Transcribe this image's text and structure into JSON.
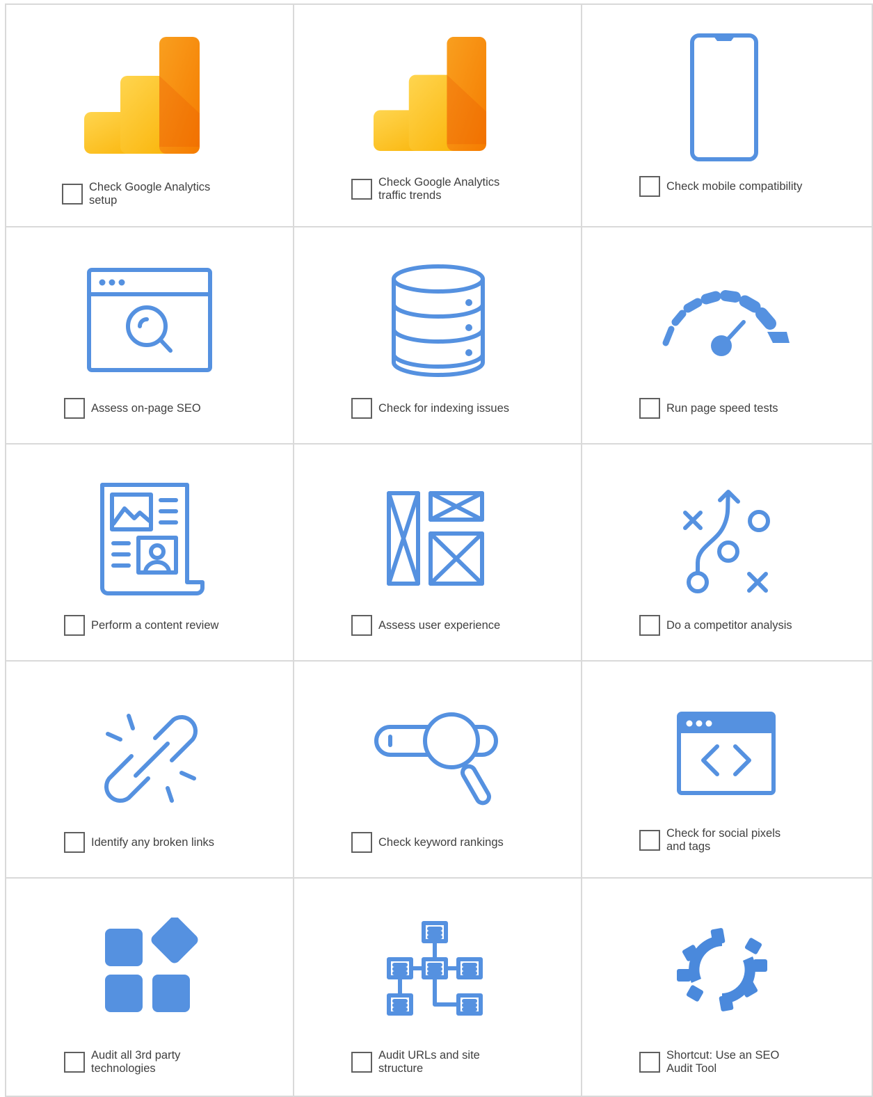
{
  "colors": {
    "icon_blue": "#5591e0",
    "ga_yellow": "#fbc02d",
    "ga_orange": "#f57c00",
    "border": "#d9d9d9"
  },
  "checklist": [
    {
      "label": "Check Google Analytics setup",
      "icon": "google-analytics-icon",
      "checked": false
    },
    {
      "label": "Check Google Analytics traffic trends",
      "icon": "google-analytics-icon",
      "checked": false
    },
    {
      "label": "Check mobile compatibility",
      "icon": "smartphone-icon",
      "checked": false
    },
    {
      "label": "Assess on-page SEO",
      "icon": "browser-search-icon",
      "checked": false
    },
    {
      "label": "Check for indexing issues",
      "icon": "database-icon",
      "checked": false
    },
    {
      "label": "Run page speed tests",
      "icon": "speedometer-icon",
      "checked": false
    },
    {
      "label": "Perform a content review",
      "icon": "content-document-icon",
      "checked": false
    },
    {
      "label": "Assess user experience",
      "icon": "wireframe-icon",
      "checked": false
    },
    {
      "label": "Do a competitor analysis",
      "icon": "strategy-play-icon",
      "checked": false
    },
    {
      "label": "Identify any broken links",
      "icon": "broken-link-icon",
      "checked": false
    },
    {
      "label": "Check keyword rankings",
      "icon": "search-bar-icon",
      "checked": false
    },
    {
      "label": "Check for social pixels and tags",
      "icon": "browser-code-icon",
      "checked": false
    },
    {
      "label": "Audit all 3rd party technologies",
      "icon": "app-blocks-icon",
      "checked": false
    },
    {
      "label": "Audit URLs and site structure",
      "icon": "sitemap-icon",
      "checked": false
    },
    {
      "label": "Shortcut: Use an SEO Audit Tool",
      "icon": "audit-gear-icon",
      "checked": false
    }
  ]
}
